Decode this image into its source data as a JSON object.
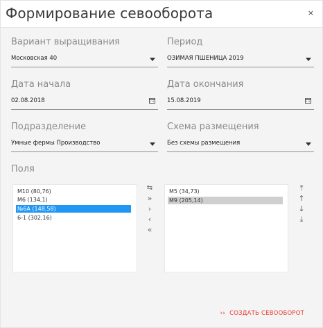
{
  "dialog": {
    "title": "Формирование севооборота",
    "close_label": "×"
  },
  "form": {
    "variant": {
      "label": "Вариант выращивания",
      "value": "Московская 40"
    },
    "period": {
      "label": "Период",
      "value": "ОЗИМАЯ ПШЕНИЦА 2019"
    },
    "start_date": {
      "label": "Дата начала",
      "value": "02.08.2018"
    },
    "end_date": {
      "label": "Дата окончания",
      "value": "15.08.2019"
    },
    "division": {
      "label": "Подразделение",
      "value": "Умные фермы Производство"
    },
    "scheme": {
      "label": "Схема размещения",
      "value": "Без схемы размещения"
    }
  },
  "fields": {
    "label": "Поля",
    "available": [
      {
        "text": "М10 (80,76)",
        "selected": false
      },
      {
        "text": "М6 (134,1)",
        "selected": false
      },
      {
        "text": "№6А (148,58)",
        "selected": true
      },
      {
        "text": "6-1 (302,16)",
        "selected": false
      }
    ],
    "chosen": [
      {
        "text": "М5 (34,73)",
        "selected": false
      },
      {
        "text": "М9 (205,14)",
        "selected": true
      }
    ]
  },
  "transfer_buttons": [
    "⇆",
    "»",
    "›",
    "‹",
    "«"
  ],
  "order_buttons": [
    "⤒",
    "↑",
    "↓",
    "⤓"
  ],
  "action": {
    "chevron": "››",
    "label": "СОЗДАТЬ СЕВООБОРОТ"
  },
  "colors": {
    "selected_blue": "#2196f3",
    "selected_grey": "#cfcfcf",
    "action_red": "#e53935"
  },
  "icons": {
    "date_picker": "calendar-icon",
    "dropdown": "caret-down-icon"
  }
}
